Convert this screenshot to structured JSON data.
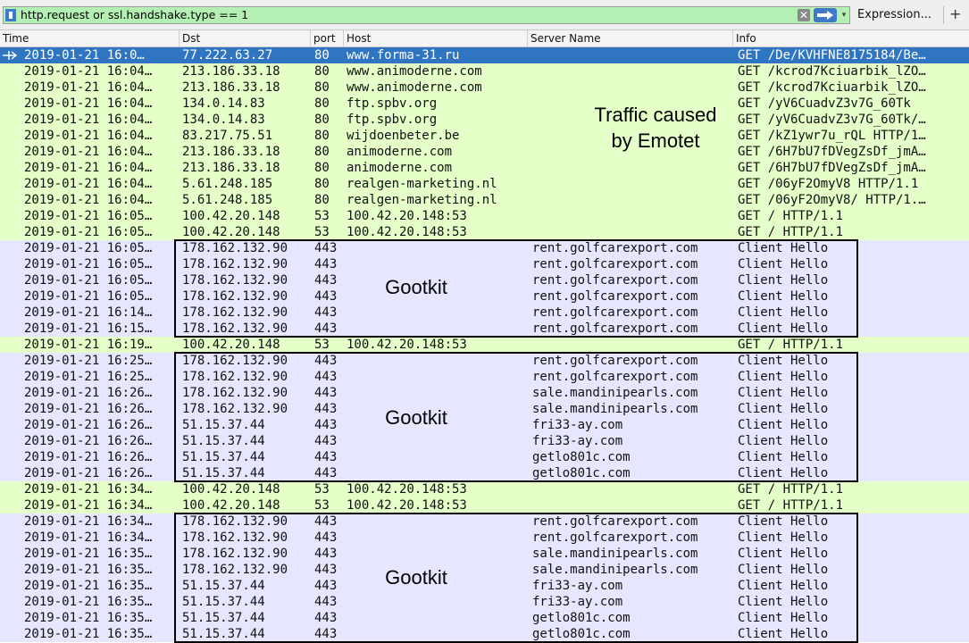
{
  "filter": {
    "value": "http.request or ssl.handshake.type == 1",
    "expression_label": "Expression...",
    "plus_label": "+",
    "clear_label": "✕",
    "dropdown_label": "▾"
  },
  "columns": [
    "Time",
    "Dst",
    "port",
    "Host",
    "Server Name",
    "Info"
  ],
  "colors": {
    "green_row": "#e4ffc7",
    "purple_row": "#e7e6ff",
    "selected_row": "#2f75c1"
  },
  "rows": [
    {
      "time": "2019-01-21 16:0…",
      "dst": "77.222.63.27",
      "port": "80",
      "host": "www.forma-31.ru",
      "server": "",
      "info": "GET /De/KVHFNE8175184/Be…",
      "type": "green",
      "selected": true
    },
    {
      "time": "2019-01-21 16:04…",
      "dst": "213.186.33.18",
      "port": "80",
      "host": "www.animoderne.com",
      "server": "",
      "info": "GET /kcrod7Kciuarbik_lZO…",
      "type": "green"
    },
    {
      "time": "2019-01-21 16:04…",
      "dst": "213.186.33.18",
      "port": "80",
      "host": "www.animoderne.com",
      "server": "",
      "info": "GET /kcrod7Kciuarbik_lZO…",
      "type": "green"
    },
    {
      "time": "2019-01-21 16:04…",
      "dst": "134.0.14.83",
      "port": "80",
      "host": "ftp.spbv.org",
      "server": "",
      "info": "GET /yV6CuadvZ3v7G_60Tk ",
      "type": "green"
    },
    {
      "time": "2019-01-21 16:04…",
      "dst": "134.0.14.83",
      "port": "80",
      "host": "ftp.spbv.org",
      "server": "",
      "info": "GET /yV6CuadvZ3v7G_60Tk/…",
      "type": "green"
    },
    {
      "time": "2019-01-21 16:04…",
      "dst": "83.217.75.51",
      "port": "80",
      "host": "wijdoenbeter.be",
      "server": "",
      "info": "GET /kZ1ywr7u_rQL HTTP/1…",
      "type": "green"
    },
    {
      "time": "2019-01-21 16:04…",
      "dst": "213.186.33.18",
      "port": "80",
      "host": "animoderne.com",
      "server": "",
      "info": "GET /6H7bU7fDVegZsDf_jmA…",
      "type": "green"
    },
    {
      "time": "2019-01-21 16:04…",
      "dst": "213.186.33.18",
      "port": "80",
      "host": "animoderne.com",
      "server": "",
      "info": "GET /6H7bU7fDVegZsDf_jmA…",
      "type": "green"
    },
    {
      "time": "2019-01-21 16:04…",
      "dst": "5.61.248.185",
      "port": "80",
      "host": "realgen-marketing.nl",
      "server": "",
      "info": "GET /06yF2OmyV8 HTTP/1.1",
      "type": "green"
    },
    {
      "time": "2019-01-21 16:04…",
      "dst": "5.61.248.185",
      "port": "80",
      "host": "realgen-marketing.nl",
      "server": "",
      "info": "GET /06yF2OmyV8/ HTTP/1.…",
      "type": "green"
    },
    {
      "time": "2019-01-21 16:05…",
      "dst": "100.42.20.148",
      "port": "53",
      "host": "100.42.20.148:53",
      "server": "",
      "info": "GET / HTTP/1.1",
      "type": "green"
    },
    {
      "time": "2019-01-21 16:05…",
      "dst": "100.42.20.148",
      "port": "53",
      "host": "100.42.20.148:53",
      "server": "",
      "info": "GET / HTTP/1.1",
      "type": "green"
    },
    {
      "time": "2019-01-21 16:05…",
      "dst": "178.162.132.90",
      "port": "443",
      "host": "",
      "server": "rent.golfcarexport.com",
      "info": "Client Hello",
      "type": "purple"
    },
    {
      "time": "2019-01-21 16:05…",
      "dst": "178.162.132.90",
      "port": "443",
      "host": "",
      "server": "rent.golfcarexport.com",
      "info": "Client Hello",
      "type": "purple"
    },
    {
      "time": "2019-01-21 16:05…",
      "dst": "178.162.132.90",
      "port": "443",
      "host": "",
      "server": "rent.golfcarexport.com",
      "info": "Client Hello",
      "type": "purple"
    },
    {
      "time": "2019-01-21 16:05…",
      "dst": "178.162.132.90",
      "port": "443",
      "host": "",
      "server": "rent.golfcarexport.com",
      "info": "Client Hello",
      "type": "purple"
    },
    {
      "time": "2019-01-21 16:14…",
      "dst": "178.162.132.90",
      "port": "443",
      "host": "",
      "server": "rent.golfcarexport.com",
      "info": "Client Hello",
      "type": "purple"
    },
    {
      "time": "2019-01-21 16:15…",
      "dst": "178.162.132.90",
      "port": "443",
      "host": "",
      "server": "rent.golfcarexport.com",
      "info": "Client Hello",
      "type": "purple"
    },
    {
      "time": "2019-01-21 16:19…",
      "dst": "100.42.20.148",
      "port": "53",
      "host": "100.42.20.148:53",
      "server": "",
      "info": "GET / HTTP/1.1",
      "type": "green"
    },
    {
      "time": "2019-01-21 16:25…",
      "dst": "178.162.132.90",
      "port": "443",
      "host": "",
      "server": "rent.golfcarexport.com",
      "info": "Client Hello",
      "type": "purple"
    },
    {
      "time": "2019-01-21 16:25…",
      "dst": "178.162.132.90",
      "port": "443",
      "host": "",
      "server": "rent.golfcarexport.com",
      "info": "Client Hello",
      "type": "purple"
    },
    {
      "time": "2019-01-21 16:26…",
      "dst": "178.162.132.90",
      "port": "443",
      "host": "",
      "server": "sale.mandinipearls.com",
      "info": "Client Hello",
      "type": "purple"
    },
    {
      "time": "2019-01-21 16:26…",
      "dst": "178.162.132.90",
      "port": "443",
      "host": "",
      "server": "sale.mandinipearls.com",
      "info": "Client Hello",
      "type": "purple"
    },
    {
      "time": "2019-01-21 16:26…",
      "dst": "51.15.37.44",
      "port": "443",
      "host": "",
      "server": "fri33-ay.com",
      "info": "Client Hello",
      "type": "purple"
    },
    {
      "time": "2019-01-21 16:26…",
      "dst": "51.15.37.44",
      "port": "443",
      "host": "",
      "server": "fri33-ay.com",
      "info": "Client Hello",
      "type": "purple"
    },
    {
      "time": "2019-01-21 16:26…",
      "dst": "51.15.37.44",
      "port": "443",
      "host": "",
      "server": "getlo801c.com",
      "info": "Client Hello",
      "type": "purple"
    },
    {
      "time": "2019-01-21 16:26…",
      "dst": "51.15.37.44",
      "port": "443",
      "host": "",
      "server": "getlo801c.com",
      "info": "Client Hello",
      "type": "purple"
    },
    {
      "time": "2019-01-21 16:34…",
      "dst": "100.42.20.148",
      "port": "53",
      "host": "100.42.20.148:53",
      "server": "",
      "info": "GET / HTTP/1.1",
      "type": "green"
    },
    {
      "time": "2019-01-21 16:34…",
      "dst": "100.42.20.148",
      "port": "53",
      "host": "100.42.20.148:53",
      "server": "",
      "info": "GET / HTTP/1.1",
      "type": "green"
    },
    {
      "time": "2019-01-21 16:34…",
      "dst": "178.162.132.90",
      "port": "443",
      "host": "",
      "server": "rent.golfcarexport.com",
      "info": "Client Hello",
      "type": "purple"
    },
    {
      "time": "2019-01-21 16:34…",
      "dst": "178.162.132.90",
      "port": "443",
      "host": "",
      "server": "rent.golfcarexport.com",
      "info": "Client Hello",
      "type": "purple"
    },
    {
      "time": "2019-01-21 16:35…",
      "dst": "178.162.132.90",
      "port": "443",
      "host": "",
      "server": "sale.mandinipearls.com",
      "info": "Client Hello",
      "type": "purple"
    },
    {
      "time": "2019-01-21 16:35…",
      "dst": "178.162.132.90",
      "port": "443",
      "host": "",
      "server": "sale.mandinipearls.com",
      "info": "Client Hello",
      "type": "purple"
    },
    {
      "time": "2019-01-21 16:35…",
      "dst": "51.15.37.44",
      "port": "443",
      "host": "",
      "server": "fri33-ay.com",
      "info": "Client Hello",
      "type": "purple"
    },
    {
      "time": "2019-01-21 16:35…",
      "dst": "51.15.37.44",
      "port": "443",
      "host": "",
      "server": "fri33-ay.com",
      "info": "Client Hello",
      "type": "purple"
    },
    {
      "time": "2019-01-21 16:35…",
      "dst": "51.15.37.44",
      "port": "443",
      "host": "",
      "server": "getlo801c.com",
      "info": "Client Hello",
      "type": "purple"
    },
    {
      "time": "2019-01-21 16:35…",
      "dst": "51.15.37.44",
      "port": "443",
      "host": "",
      "server": "getlo801c.com",
      "info": "Client Hello",
      "type": "purple"
    }
  ],
  "annotations": {
    "emotet": "Traffic caused by Emotet",
    "gootkit_1": "Gootkit",
    "gootkit_2": "Gootkit",
    "gootkit_3": "Gootkit"
  }
}
